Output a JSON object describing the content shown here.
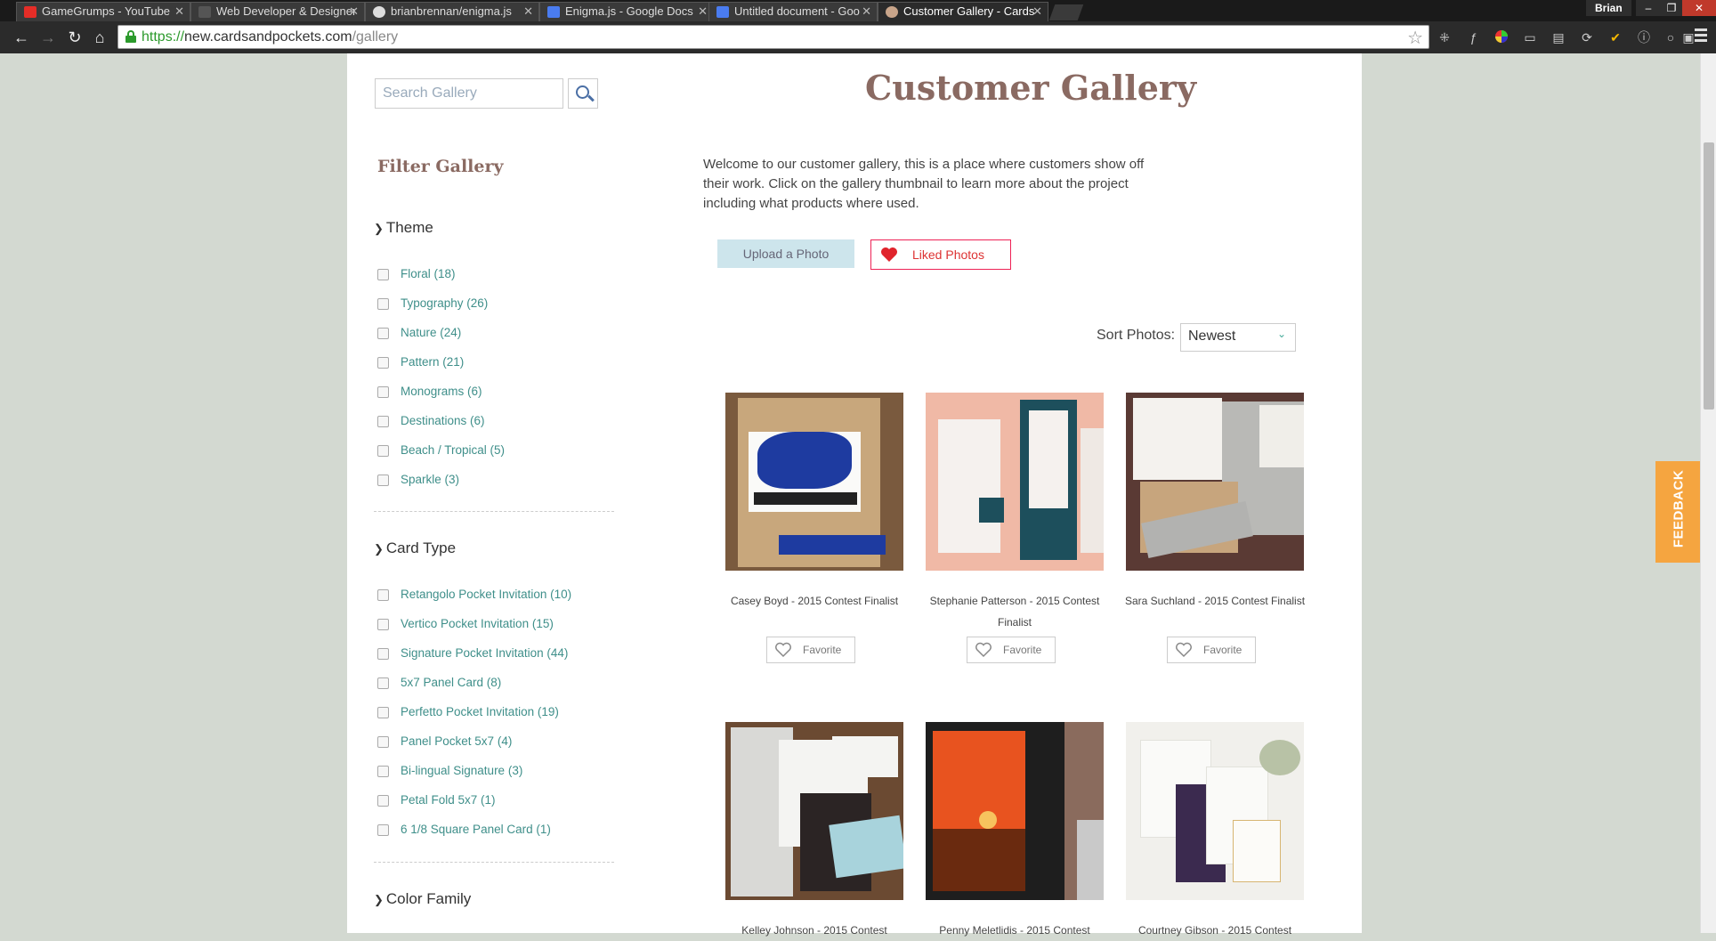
{
  "browser": {
    "tabs": [
      {
        "title": "GameGrumps - YouTube",
        "icon": "youtube-icon",
        "color": "#e52d27",
        "active": false
      },
      {
        "title": "Web Developer & Designer",
        "icon": "page-icon",
        "color": "#555555",
        "active": false
      },
      {
        "title": "brianbrennan/enigma.js",
        "icon": "github-icon",
        "color": "#dddddd",
        "active": false
      },
      {
        "title": "Enigma.js - Google Docs",
        "icon": "docs-icon",
        "color": "#4a7cf0",
        "active": false
      },
      {
        "title": "Untitled document - Goo",
        "icon": "docs-icon",
        "color": "#4a7cf0",
        "active": false
      },
      {
        "title": "Customer Gallery - Cards",
        "icon": "site-icon",
        "color": "#c9a58a",
        "active": true
      }
    ],
    "profile": "Brian",
    "url_protocol": "https://",
    "url_host": "new.cardsandpockets.com",
    "url_path": "/gallery"
  },
  "sidebar": {
    "search_placeholder": "Search Gallery",
    "filter_title": "Filter Gallery",
    "sections": [
      {
        "title": "Theme",
        "options": [
          "Floral (18)",
          "Typography (26)",
          "Nature (24)",
          "Pattern (21)",
          "Monograms (6)",
          "Destinations (6)",
          "Beach / Tropical (5)",
          "Sparkle (3)"
        ]
      },
      {
        "title": "Card Type",
        "options": [
          "Retangolo Pocket Invitation (10)",
          "Vertico Pocket Invitation (15)",
          "Signature Pocket Invitation (44)",
          "5x7 Panel Card (8)",
          "Perfetto Pocket Invitation (19)",
          "Panel Pocket 5x7 (4)",
          "Bi-lingual Signature (3)",
          "Petal Fold 5x7 (1)",
          "6 1/8 Square Panel Card (1)"
        ]
      },
      {
        "title": "Color Family",
        "options": []
      }
    ]
  },
  "main": {
    "title": "Customer Gallery",
    "intro": "Welcome to our customer gallery, this is a place where customers show off their work. Click on the gallery thumbnail to learn more about the project including what products where used.",
    "upload_label": "Upload a Photo",
    "liked_label": "Liked Photos",
    "sort_label": "Sort Photos:",
    "sort_value": "Newest",
    "favorite_label": "Favorite",
    "gallery": [
      {
        "caption": "Casey Boyd - 2015 Contest Finalist",
        "colors": [
          "#7a5a3e",
          "#c8a77c",
          "#1e3ba0"
        ]
      },
      {
        "caption": "Stephanie Patterson - 2015 Contest Finalist",
        "colors": [
          "#f0b9a6",
          "#1d4f5c",
          "#f5f1ee"
        ]
      },
      {
        "caption": "Sara Suchland - 2015 Contest Finalist",
        "colors": [
          "#5a3a34",
          "#c7a57d",
          "#b9b9b6"
        ]
      },
      {
        "caption": "Kelley Johnson - 2015 Contest",
        "colors": [
          "#6b4a32",
          "#2b2424",
          "#d9d9d6"
        ]
      },
      {
        "caption": "Penny Meletlidis - 2015 Contest",
        "colors": [
          "#1e1e1e",
          "#e8531f",
          "#8a6b5d"
        ]
      },
      {
        "caption": "Courtney Gibson - 2015 Contest",
        "colors": [
          "#f1f0ec",
          "#3b2a4f",
          "#d7b572"
        ]
      }
    ]
  },
  "feedback_label": "FEEDBACK"
}
